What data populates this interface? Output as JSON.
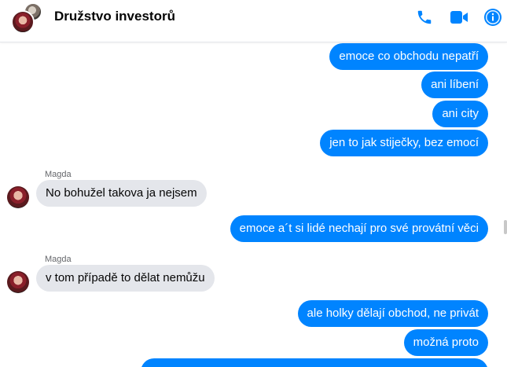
{
  "header": {
    "title": "Družstvo investorů",
    "accent_color": "#0084ff",
    "icons": [
      "phone-icon",
      "video-camera-icon",
      "info-icon"
    ]
  },
  "messages": [
    {
      "direction": "out",
      "text": "emoce co obchodu nepatří"
    },
    {
      "direction": "out",
      "text": "ani líbení"
    },
    {
      "direction": "out",
      "text": "ani city"
    },
    {
      "direction": "out",
      "text": "jen to jak stiječky, bez emocí"
    },
    {
      "direction": "in",
      "sender": "Magda",
      "text": "No bohužel takova ja nejsem"
    },
    {
      "direction": "out",
      "text": "emoce a´t si lidé nechají pro své provátní věci"
    },
    {
      "direction": "in",
      "sender": "Magda",
      "text": "v tom případě to dělat nemůžu"
    },
    {
      "direction": "out",
      "text": "ale holky dělají obchod, ne privát"
    },
    {
      "direction": "out",
      "text": "možná proto"
    }
  ],
  "colors": {
    "outgoing_bubble": "#0084ff",
    "incoming_bubble": "#e4e6eb"
  }
}
